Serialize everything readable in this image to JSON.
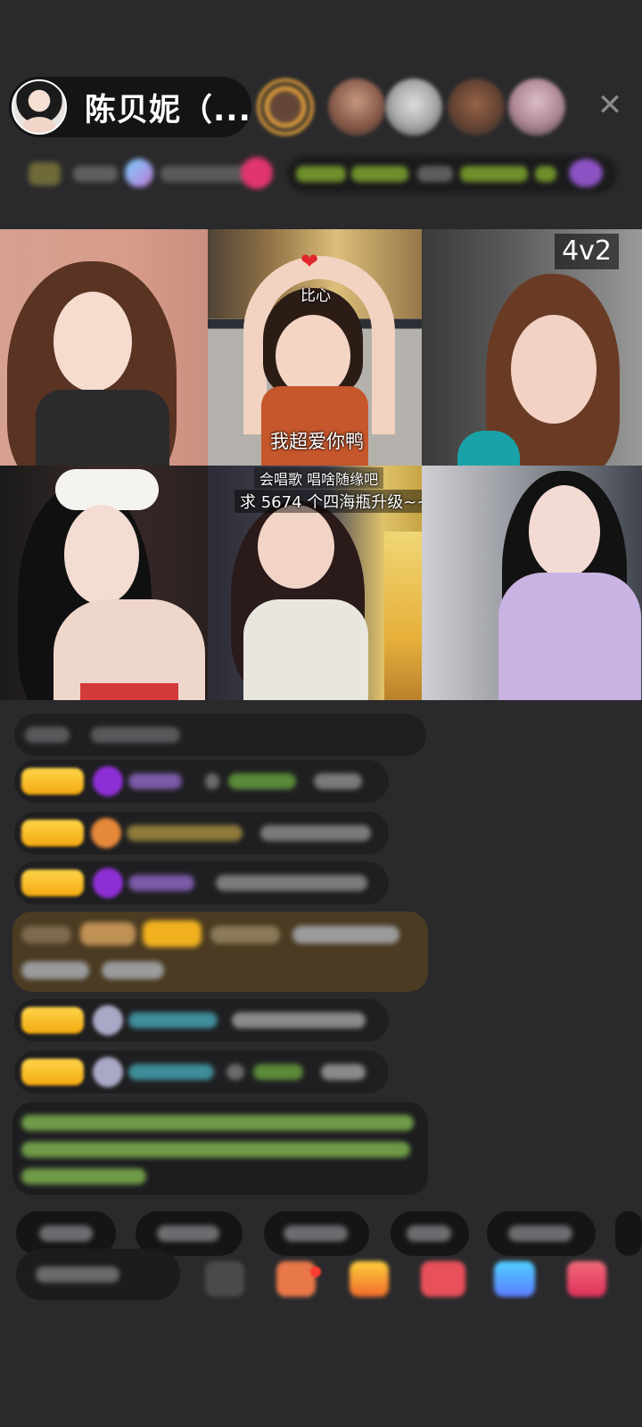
{
  "host": {
    "name": "陈贝妮（...",
    "close_icon": "close-icon"
  },
  "grid": {
    "mode_badge": "4v2",
    "cells": [
      {
        "id": "guest-1",
        "overlay": ""
      },
      {
        "id": "guest-2",
        "sticker_top": "比心",
        "caption": "我超爱你鸭"
      },
      {
        "id": "guest-3",
        "overlay": ""
      },
      {
        "id": "guest-4",
        "overlay": ""
      },
      {
        "id": "guest-5",
        "note_line1": "会唱歌   唱啥随缘吧",
        "note_line2": "求 5674 个四海瓶升级~~"
      },
      {
        "id": "guest-6",
        "overlay": ""
      }
    ]
  },
  "colors": {
    "background": "#2a2a2c",
    "gold_badge": "#f3b21a",
    "purple_gem": "#8e2fd6",
    "system_green": "#8ccf5a",
    "highlight_row": "#4a3b22"
  }
}
